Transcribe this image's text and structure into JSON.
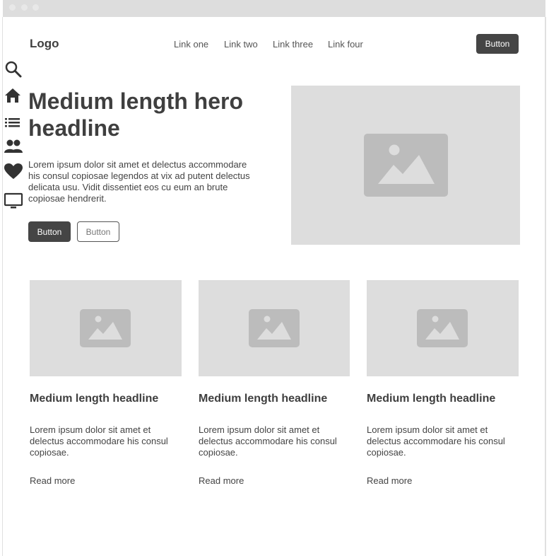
{
  "header": {
    "logo": "Logo",
    "nav_links": [
      "Link one",
      "Link two",
      "Link three",
      "Link four"
    ],
    "button_label": "Button"
  },
  "sidebar": {
    "icons": [
      "search-icon",
      "home-icon",
      "list-icon",
      "people-icon",
      "heart-icon",
      "monitor-icon"
    ]
  },
  "hero": {
    "headline": "Medium length hero headline",
    "body": "Lorem ipsum dolor sit amet et delectus accommodare his consul copiosae legendos at vix ad putent delectus delicata usu. Vidit dissentiet eos cu eum an brute copiosae hendrerit.",
    "primary_button": "Button",
    "secondary_button": "Button",
    "image_icon": "image-placeholder-icon"
  },
  "cards": [
    {
      "headline": "Medium length headline",
      "body": "Lorem ipsum dolor sit amet et delectus accommodare his consul copiosae.",
      "link": "Read more",
      "image_icon": "image-placeholder-icon"
    },
    {
      "headline": "Medium length headline",
      "body": "Lorem ipsum dolor sit amet et delectus accommodare his consul copiosae.",
      "link": "Read more",
      "image_icon": "image-placeholder-icon"
    },
    {
      "headline": "Medium length headline",
      "body": "Lorem ipsum dolor sit amet et delectus accommodare his consul copiosae.",
      "link": "Read more",
      "image_icon": "image-placeholder-icon"
    }
  ],
  "colors": {
    "dark": "#454545",
    "placeholder": "#dddddd",
    "placeholder_icon": "#bcbcbc",
    "titlebar": "#dddddd"
  }
}
